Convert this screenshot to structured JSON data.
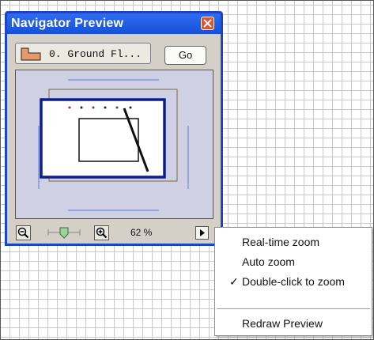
{
  "palette": {
    "title": "Navigator Preview",
    "story_label": "0. Ground Fl...",
    "go_label": "Go",
    "zoom_value": "62 %"
  },
  "menu": {
    "items": [
      {
        "label": "Real-time zoom",
        "checked": false
      },
      {
        "label": "Auto zoom",
        "checked": false
      },
      {
        "label": "Double-click to zoom",
        "checked": true,
        "check_mark": "✓"
      },
      {
        "label": "Redraw Preview",
        "checked": false
      }
    ]
  },
  "colors": {
    "titlebar": "#1c44c6",
    "close_button": "#e3522b",
    "preview_bg": "#d0d0e4",
    "viewport_frame": "#0b1f8a"
  }
}
